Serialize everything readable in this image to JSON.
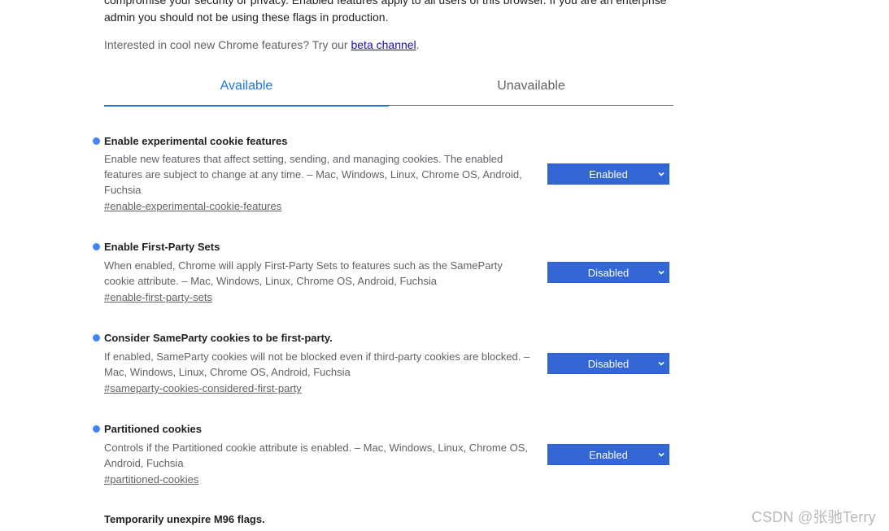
{
  "intro": {
    "warning_line1": "compromise your security or privacy. Enabled features apply to all users of this browser. If you are an enterprise",
    "warning_line2": "admin you should not be using these flags in production.",
    "beta_prefix": "Interested in cool new Chrome features? Try our ",
    "beta_link": "beta channel",
    "beta_suffix": "."
  },
  "tabs": [
    {
      "label": "Available",
      "active": true
    },
    {
      "label": "Unavailable",
      "active": false
    }
  ],
  "experiments": [
    {
      "name": "Enable experimental cookie features",
      "description": "Enable new features that affect setting, sending, and managing cookies. The enabled features are subject to change at any time. – Mac, Windows, Linux, Chrome OS, Android, Fuchsia",
      "link": "#enable-experimental-cookie-features",
      "value": "Enabled"
    },
    {
      "name": "Enable First-Party Sets",
      "description": "When enabled, Chrome will apply First-Party Sets to features such as the SameParty cookie attribute. – Mac, Windows, Linux, Chrome OS, Android, Fuchsia",
      "link": "#enable-first-party-sets",
      "value": "Disabled"
    },
    {
      "name": "Consider SameParty cookies to be first-party.",
      "description": "If enabled, SameParty cookies will not be blocked even if third-party cookies are blocked. – Mac, Windows, Linux, Chrome OS, Android, Fuchsia",
      "link": "#sameparty-cookies-considered-first-party",
      "value": "Disabled"
    },
    {
      "name": "Partitioned cookies",
      "description": "Controls if the Partitioned cookie attribute is enabled. – Mac, Windows, Linux, Chrome OS, Android, Fuchsia",
      "link": "#partitioned-cookies",
      "value": "Enabled"
    }
  ],
  "trailing_experiment": {
    "name": "Temporarily unexpire M96 flags."
  },
  "watermark": "CSDN @张驰Terry",
  "colors": {
    "accent": "#1a73e8",
    "select_bg": "#3367d6",
    "dot": "#4285f4"
  }
}
